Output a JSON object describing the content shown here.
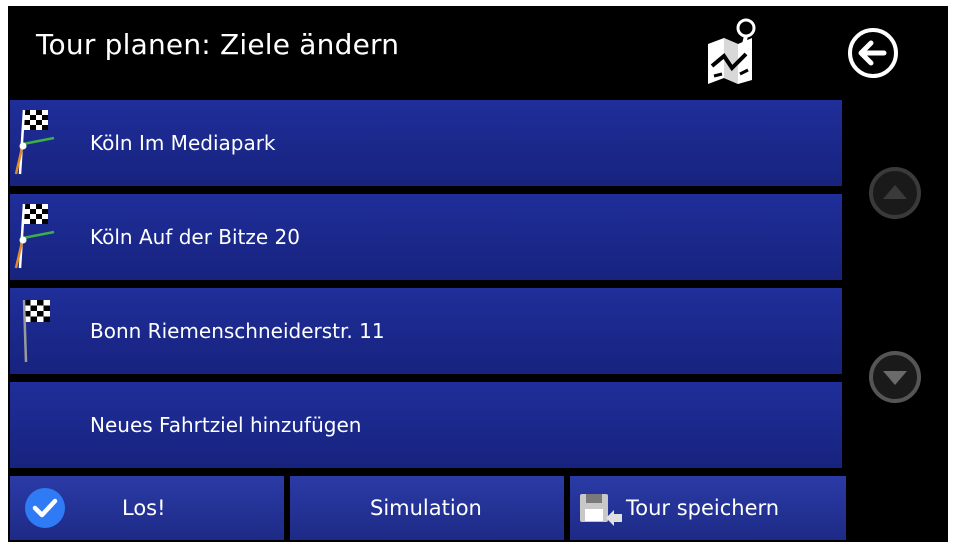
{
  "header": {
    "title": "Tour planen: Ziele ändern"
  },
  "icons": {
    "map": "map-route-icon",
    "back": "back-arrow-icon",
    "up": "scroll-up-icon",
    "down": "scroll-down-icon",
    "flag": "checkered-flag-icon",
    "check": "checkmark-icon",
    "save": "save-disk-icon"
  },
  "destinations": [
    {
      "label": "Köln Im Mediapark",
      "icon": "checkered-flag-route-icon"
    },
    {
      "label": "Köln Auf der Bitze 20",
      "icon": "checkered-flag-route-icon"
    },
    {
      "label": "Bonn Riemenschneiderstr. 11",
      "icon": "checkered-flag-icon"
    }
  ],
  "add_destination": {
    "label": "Neues Fahrtziel hinzufügen"
  },
  "bottom_bar": {
    "go_label": "Los!",
    "simulation_label": "Simulation",
    "save_label": "Tour speichern"
  },
  "colors": {
    "background": "#000000",
    "row": "#1f2e9a",
    "button": "#2b3ba6",
    "check": "#2f7bf5",
    "route_green": "#3cb043",
    "route_orange": "#e08a2a"
  }
}
